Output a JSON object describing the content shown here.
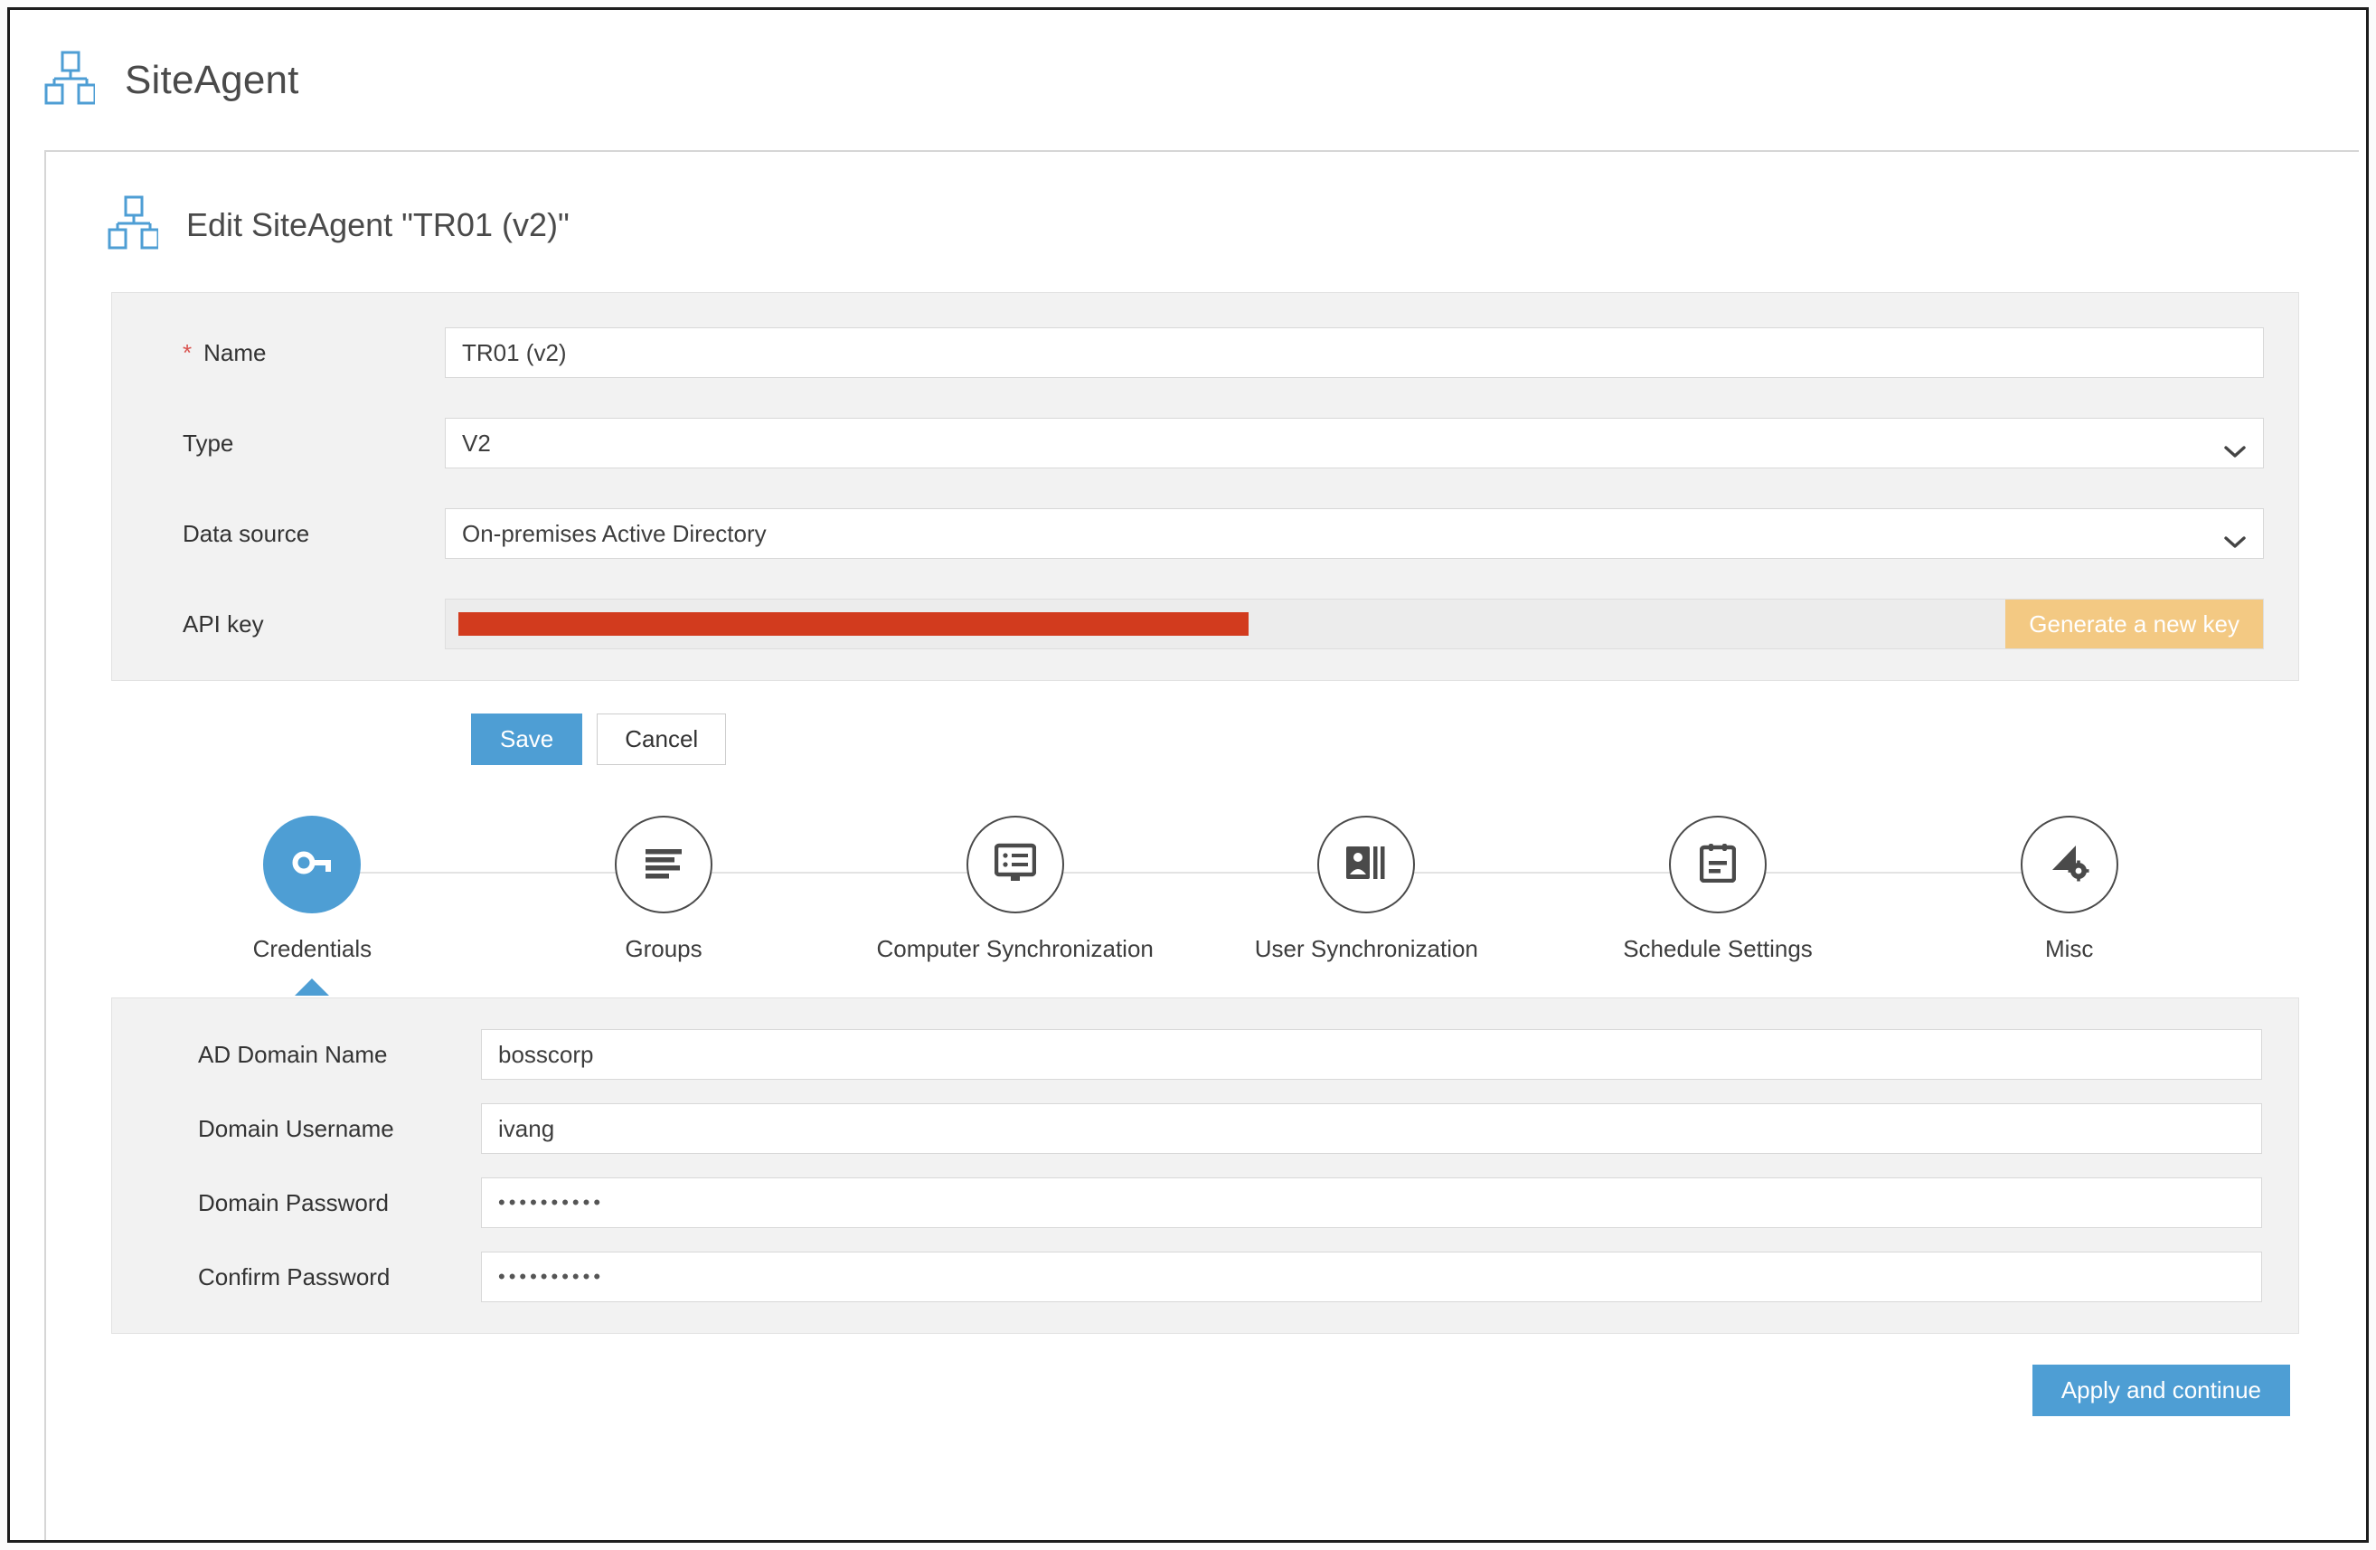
{
  "app": {
    "title": "SiteAgent",
    "logo_icon": "sitemap-icon"
  },
  "page": {
    "title": "Edit SiteAgent \"TR01 (v2)\"",
    "icon": "sitemap-icon"
  },
  "colors": {
    "accent_blue": "#4e9ed4",
    "warning_orange": "#f3c983",
    "redacted_red": "#d23b1e",
    "required_red": "#d9534f",
    "panel_gray": "#f2f2f2",
    "border_gray": "#d8d8d8"
  },
  "form": {
    "fields": [
      {
        "label": "Name",
        "required": true,
        "type": "text",
        "value": "TR01 (v2)",
        "placeholder": ""
      },
      {
        "label": "Type",
        "required": false,
        "type": "select",
        "value": "V2",
        "options": [
          "V2"
        ]
      },
      {
        "label": "Data source",
        "required": false,
        "type": "select",
        "value": "On-premises Active Directory",
        "options": [
          "On-premises Active Directory"
        ]
      }
    ],
    "api_key": {
      "label": "API key",
      "value_redacted": true,
      "generate_button": "Generate a new key"
    },
    "required_marker": "*"
  },
  "actions": {
    "save": "Save",
    "cancel": "Cancel",
    "apply_continue": "Apply and continue"
  },
  "stepper": {
    "active_index": 0,
    "steps": [
      {
        "label": "Credentials",
        "icon": "key-icon"
      },
      {
        "label": "Groups",
        "icon": "list-icon"
      },
      {
        "label": "Computer Synchronization",
        "icon": "monitor-icon"
      },
      {
        "label": "User Synchronization",
        "icon": "contact-card-icon"
      },
      {
        "label": "Schedule Settings",
        "icon": "calendar-icon"
      },
      {
        "label": "Misc",
        "icon": "cursor-gear-icon"
      }
    ]
  },
  "credentials": {
    "fields": [
      {
        "label": "AD Domain Name",
        "type": "text",
        "value": "bosscorp",
        "placeholder": ""
      },
      {
        "label": "Domain Username",
        "type": "text",
        "value": "ivang",
        "placeholder": ""
      },
      {
        "label": "Domain Password",
        "type": "password",
        "value": "••••••••••",
        "placeholder": ""
      },
      {
        "label": "Confirm Password",
        "type": "password",
        "value": "••••••••••",
        "placeholder": ""
      }
    ]
  }
}
